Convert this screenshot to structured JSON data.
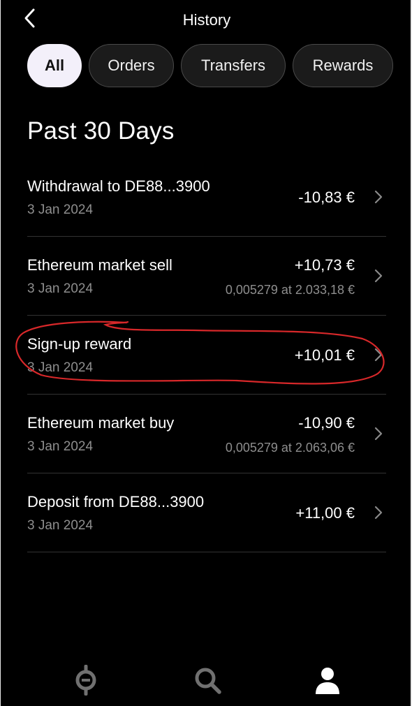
{
  "header": {
    "title": "History"
  },
  "filters": [
    {
      "label": "All",
      "selected": true
    },
    {
      "label": "Orders",
      "selected": false
    },
    {
      "label": "Transfers",
      "selected": false
    },
    {
      "label": "Rewards",
      "selected": false
    }
  ],
  "section": {
    "title": "Past 30 Days"
  },
  "transactions": [
    {
      "title": "Withdrawal to DE88...3900",
      "date": "3 Jan 2024",
      "amount": "-10,83 €",
      "detail": ""
    },
    {
      "title": "Ethereum market sell",
      "date": "3 Jan 2024",
      "amount": "+10,73 €",
      "detail": "0,005279 at 2.033,18 €"
    },
    {
      "title": "Sign-up reward",
      "date": "3 Jan 2024",
      "amount": "+10,01 €",
      "detail": ""
    },
    {
      "title": "Ethereum market buy",
      "date": "3 Jan 2024",
      "amount": "-10,90 €",
      "detail": "0,005279 at 2.063,06 €"
    },
    {
      "title": "Deposit from DE88...3900",
      "date": "3 Jan 2024",
      "amount": "+11,00 €",
      "detail": ""
    }
  ],
  "bottom_nav": {
    "items": [
      {
        "icon": "home-logo-icon",
        "active": false
      },
      {
        "icon": "search-icon",
        "active": false
      },
      {
        "icon": "profile-icon",
        "active": true
      }
    ]
  },
  "colors": {
    "background": "#000000",
    "chip_selected": "#f3f0fa",
    "secondary_text": "#8e8e8e",
    "annotation": "#d8282a"
  }
}
